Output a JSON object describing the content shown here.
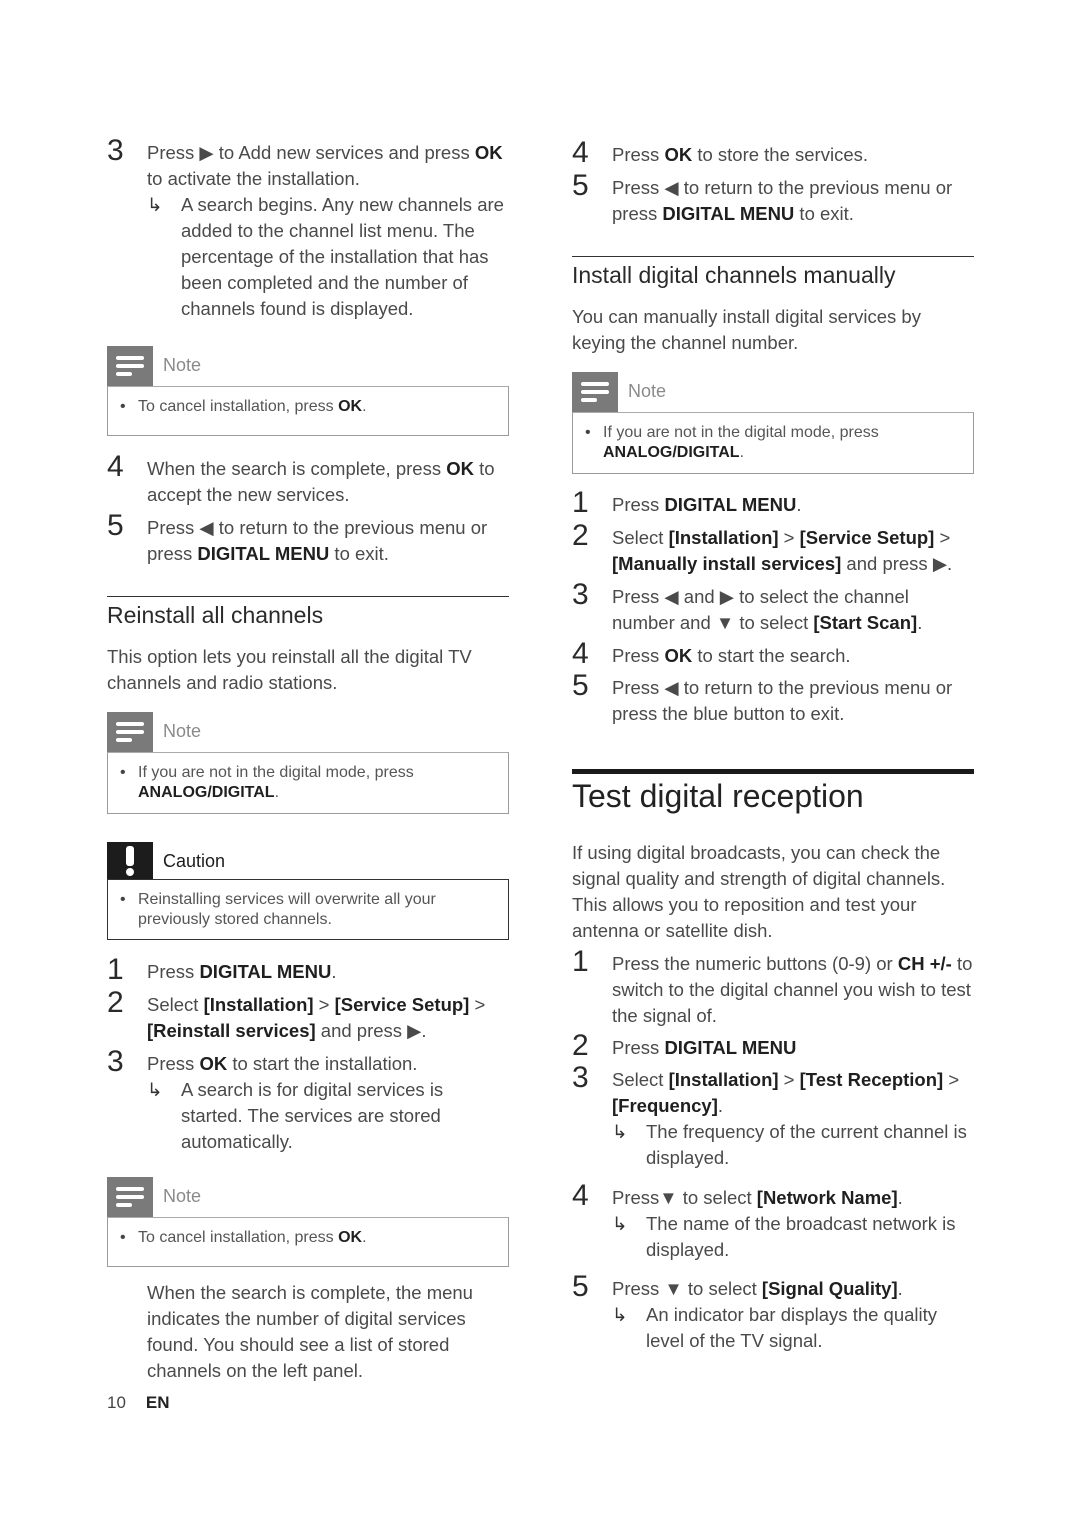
{
  "left": {
    "step3": {
      "num": "3",
      "pre": "Press ▶ to Add new services and press ",
      "bold": "OK",
      "post": " to activate the installation.",
      "result": "A search begins. Any new channels are added to the channel list menu. The percentage of the installation that has been completed and the number of channels found is displayed."
    },
    "note1": {
      "title": "Note",
      "pre": "To cancel installation, press ",
      "bold": "OK",
      "post": "."
    },
    "step4": {
      "num": "4",
      "pre": "When the search is complete, press ",
      "bold": "OK",
      "post": " to accept the new services."
    },
    "step5": {
      "num": "5",
      "pre": "Press ◀ to return to the previous menu or press ",
      "bold": "DIGITAL MENU",
      "post": " to exit."
    },
    "section_reinstall": {
      "heading": "Reinstall all channels",
      "intro": "This option lets you reinstall all the digital TV channels and radio stations."
    },
    "note2": {
      "title": "Note",
      "pre": "If you are not in the digital mode, press ",
      "bold": "ANALOG/DIGITAL",
      "post": "."
    },
    "caution": {
      "title": "Caution",
      "text": "Reinstalling services will overwrite all your previously stored channels."
    },
    "r_step1": {
      "num": "1",
      "pre": "Press ",
      "bold": "DIGITAL MENU",
      "post": "."
    },
    "r_step2": {
      "num": "2",
      "pre": "Select ",
      "b1": "[Installation]",
      "mid1": " > ",
      "b2": "[Service Setup]",
      "mid2": " > ",
      "b3": "[Reinstall services]",
      "post": " and press ▶."
    },
    "r_step3": {
      "num": "3",
      "pre": "Press ",
      "bold": "OK",
      "post": " to start the installation.",
      "result": "A search is for digital services is started. The services are stored automatically."
    },
    "note3": {
      "title": "Note",
      "pre": "To cancel installation, press ",
      "bold": "OK",
      "post": "."
    },
    "closing": "When the search is complete, the menu indicates the number of digital services found. You should see a list of stored channels on the left panel."
  },
  "right": {
    "step4": {
      "num": "4",
      "pre": "Press ",
      "bold": "OK",
      "post": " to store the services."
    },
    "step5": {
      "num": "5",
      "pre": "Press ◀ to return to the previous menu or press ",
      "bold": "DIGITAL MENU",
      "post": " to exit."
    },
    "section_manual": {
      "heading": "Install digital channels manually",
      "intro": "You can manually install digital services by keying the channel number."
    },
    "note": {
      "title": "Note",
      "pre": "If you are not in the digital mode, press ",
      "bold": "ANALOG/DIGITAL",
      "post": "."
    },
    "m_step1": {
      "num": "1",
      "pre": "Press ",
      "bold": "DIGITAL MENU",
      "post": "."
    },
    "m_step2": {
      "num": "2",
      "pre": "Select ",
      "b1": "[Installation]",
      "mid1": " > ",
      "b2": "[Service Setup]",
      "mid2": " > ",
      "b3": "[Manually install services]",
      "post": " and press ▶."
    },
    "m_step3": {
      "num": "3",
      "pre": "Press ◀ and ▶ to select the channel number and ▼ to select ",
      "bold": "[Start Scan]",
      "post": "."
    },
    "m_step4": {
      "num": "4",
      "pre": "Press ",
      "bold": "OK",
      "post": " to start the search."
    },
    "m_step5": {
      "num": "5",
      "text": "Press ◀ to return to the previous menu or press the blue button to exit."
    },
    "section_test": {
      "heading": "Test digital reception",
      "intro": "If using digital broadcasts, you can check the signal quality and strength of digital channels. This allows you to reposition and test your antenna or satellite dish."
    },
    "t_step1": {
      "num": "1",
      "pre": "Press the numeric buttons (0-9) or ",
      "bold": "CH +/-",
      "post": " to switch to the digital channel you wish to test the signal of."
    },
    "t_step2": {
      "num": "2",
      "pre": "Press ",
      "bold": "DIGITAL MENU"
    },
    "t_step3": {
      "num": "3",
      "pre": "Select ",
      "b1": "[Installation]",
      "mid1": " > ",
      "b2": "[Test Reception]",
      "mid2": " > ",
      "b3": "[Frequency]",
      "post": ".",
      "result": "The frequency of the current channel is displayed."
    },
    "t_step4": {
      "num": "4",
      "pre": "Press▼ to select ",
      "bold": "[Network Name]",
      "post": ".",
      "result": "The name of the broadcast network is displayed."
    },
    "t_step5": {
      "num": "5",
      "pre": "Press ▼ to select ",
      "bold": "[Signal Quality]",
      "post": ".",
      "result": "An indicator bar displays the quality level of the TV signal."
    }
  },
  "footer": {
    "page": "10",
    "lang": "EN"
  },
  "icons": {
    "result_arrow": "↳",
    "note": "note-lines-icon",
    "caution": "exclamation-icon"
  }
}
